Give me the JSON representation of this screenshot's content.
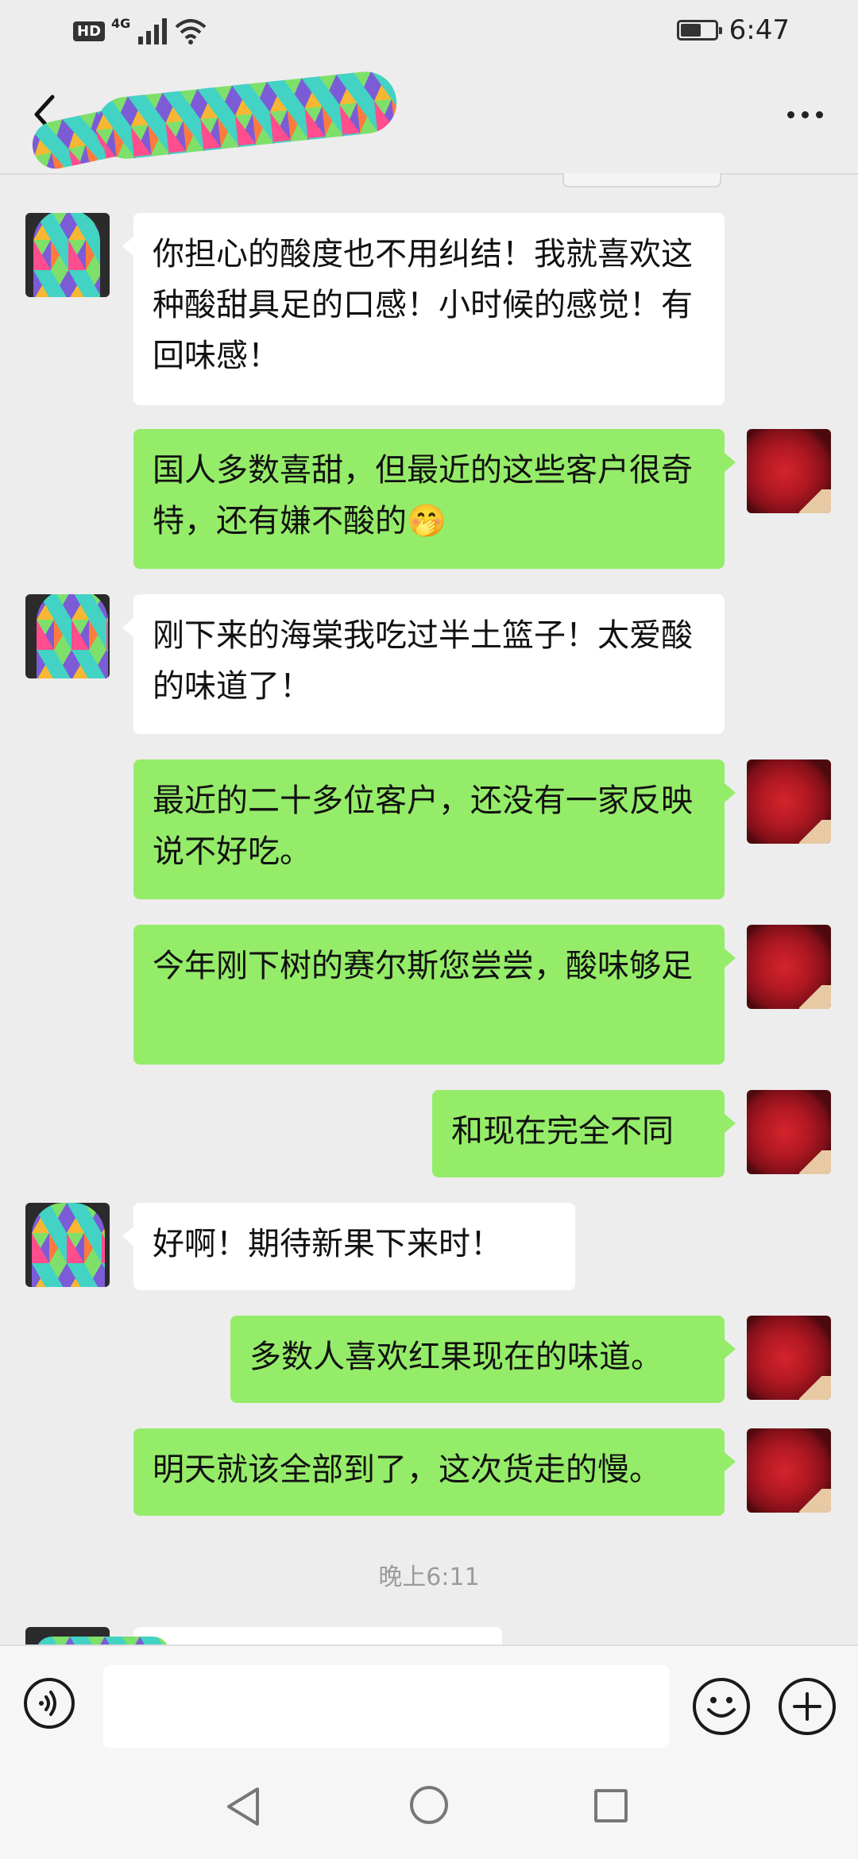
{
  "status_bar": {
    "hd": "HD",
    "network": "4G",
    "time": "6:47"
  },
  "header": {
    "contact_name": ""
  },
  "messages": [
    {
      "side": "other",
      "text": "你担心的酸度也不用纠结！我就喜欢这种酸甜具足的口感！小时候的感觉！有回味感！"
    },
    {
      "side": "self",
      "text": "国人多数喜甜，但最近的这些客户很奇特，还有嫌不酸的🤭"
    },
    {
      "side": "other",
      "text": "刚下来的海棠我吃过半土篮子！太爱酸的味道了！"
    },
    {
      "side": "self",
      "text": "最近的二十多位客户，还没有一家反映说不好吃。"
    },
    {
      "side": "self",
      "text": "今年刚下树的赛尔斯您尝尝，酸味够足"
    },
    {
      "side": "self",
      "text": "和现在完全不同"
    },
    {
      "side": "other",
      "text": "好啊！期待新果下来时！"
    },
    {
      "side": "self",
      "text": "多数人喜欢红果现在的味道。"
    },
    {
      "side": "self",
      "text": "明天就该全部到了，这次货走的慢。"
    }
  ],
  "timestamp": "晚上6:11",
  "input": {
    "value": "",
    "placeholder": ""
  },
  "icons": {
    "back": "back-arrow-icon",
    "more": "more-dots-icon",
    "voice": "voice-icon",
    "emoji": "emoji-icon",
    "plus": "plus-icon"
  },
  "colors": {
    "self_bubble": "#95ec69",
    "other_bubble": "#ffffff",
    "background": "#ededed"
  }
}
